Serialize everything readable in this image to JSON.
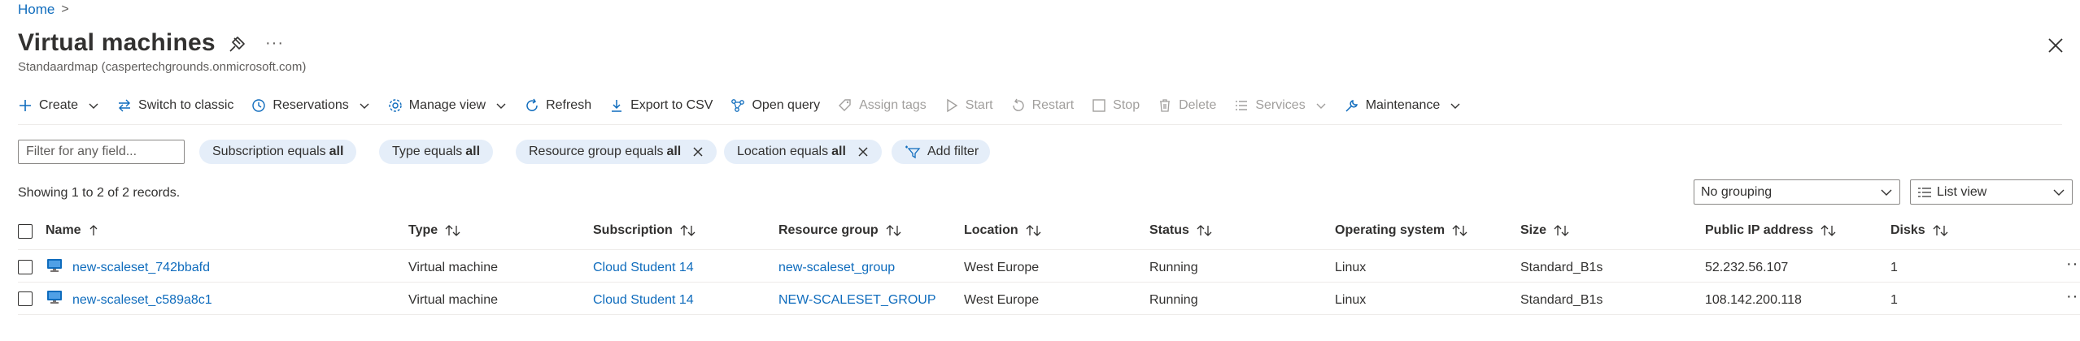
{
  "breadcrumb": {
    "home": "Home",
    "separator": ">"
  },
  "header": {
    "title": "Virtual machines",
    "subtitle": "Standaardmap (caspertechgrounds.onmicrosoft.com)",
    "more": "···"
  },
  "toolbar": {
    "create": "Create",
    "switch_to_classic": "Switch to classic",
    "reservations": "Reservations",
    "manage_view": "Manage view",
    "refresh": "Refresh",
    "export_csv": "Export to CSV",
    "open_query": "Open query",
    "assign_tags": "Assign tags",
    "start": "Start",
    "restart": "Restart",
    "stop": "Stop",
    "delete": "Delete",
    "services": "Services",
    "maintenance": "Maintenance"
  },
  "filters": {
    "placeholder": "Filter for any field...",
    "pills": [
      {
        "label": "Subscription equals",
        "value": "all"
      },
      {
        "label": "Type equals",
        "value": "all"
      },
      {
        "label": "Resource group equals",
        "value": "all"
      },
      {
        "label": "Location equals",
        "value": "all"
      }
    ],
    "add_filter": "Add filter"
  },
  "records": "Showing 1 to 2 of 2 records.",
  "grouping": {
    "selected": "No grouping"
  },
  "view": {
    "selected": "List view"
  },
  "table": {
    "columns": [
      "Name",
      "Type",
      "Subscription",
      "Resource group",
      "Location",
      "Status",
      "Operating system",
      "Size",
      "Public IP address",
      "Disks"
    ],
    "rows": [
      {
        "name": "new-scaleset_742bbafd",
        "type": "Virtual machine",
        "subscription": "Cloud Student 14",
        "resource_group": "new-scaleset_group",
        "location": "West Europe",
        "status": "Running",
        "os": "Linux",
        "size": "Standard_B1s",
        "ip": "52.232.56.107",
        "disks": "1",
        "more": "···"
      },
      {
        "name": "new-scaleset_c589a8c1",
        "type": "Virtual machine",
        "subscription": "Cloud Student 14",
        "resource_group": "NEW-SCALESET_GROUP",
        "location": "West Europe",
        "status": "Running",
        "os": "Linux",
        "size": "Standard_B1s",
        "ip": "108.142.200.118",
        "disks": "1",
        "more": "···"
      }
    ]
  },
  "colors": {
    "accent": "#0f6cbd",
    "pill_bg": "#e5eef9",
    "disabled": "#a19f9d"
  }
}
